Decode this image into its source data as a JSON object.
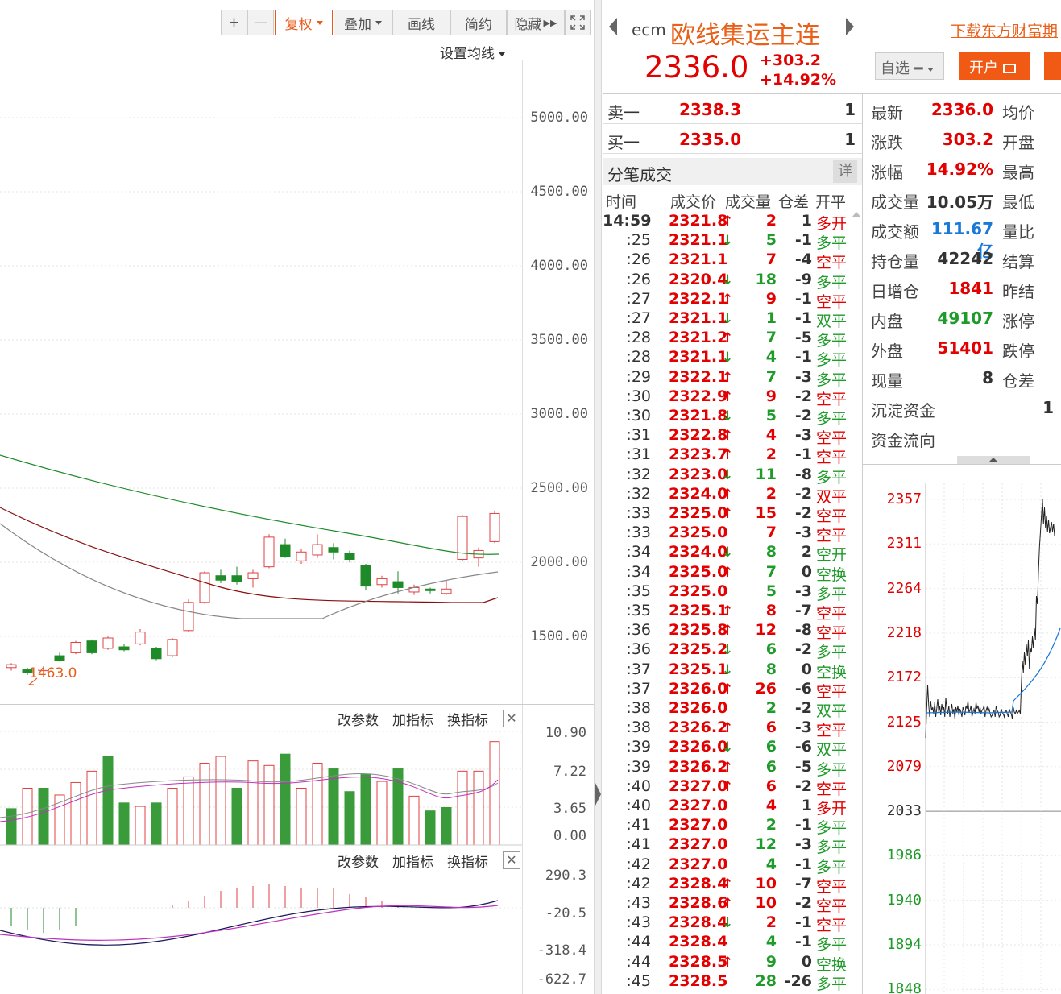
{
  "toolbar": {
    "plus_label": "+",
    "minus_label": "—",
    "fuquan_label": "复权",
    "diejia_label": "叠加",
    "huaxian_label": "画线",
    "jianyue_label": "简约",
    "yincang_label": "隐藏"
  },
  "kline": {
    "ma_setting_label": "设置均线",
    "price_axis": [
      "5000.00",
      "4500.00",
      "4000.00",
      "3500.00",
      "3000.00",
      "2500.00",
      "2000.00",
      "1500.00"
    ],
    "low_marker": "1463.0"
  },
  "volume_panel": {
    "buttons": [
      "改参数",
      "加指标",
      "换指标"
    ],
    "axis": [
      "10.90",
      "7.22",
      "3.65",
      "0.00"
    ]
  },
  "macd_panel": {
    "buttons": [
      "改参数",
      "加指标",
      "换指标"
    ],
    "axis": [
      "290.3",
      "-20.5",
      "-318.4",
      "-622.7"
    ]
  },
  "quote": {
    "code": "ecm",
    "name": "欧线集运主连",
    "download_link": "下载东方财富期",
    "price": "2336.0",
    "change": "+303.2",
    "change_pct": "+14.92%",
    "watch_label": "自选",
    "open_account_label": "开户",
    "colors": {
      "up": "#e30000",
      "down": "#1e9b28",
      "accent": "#e8601a"
    }
  },
  "orderbook": [
    {
      "label": "卖一",
      "price": "2338.3",
      "qty": "1"
    },
    {
      "label": "买一",
      "price": "2335.0",
      "qty": "1"
    }
  ],
  "ticks": {
    "title": "分笔成交",
    "detail_btn": "详",
    "headers": [
      "时间",
      "成交价",
      "成交量",
      "仓差",
      "开平"
    ],
    "rows": [
      {
        "t": "14:59",
        "p": "2321.8",
        "d": "up",
        "v": "2",
        "v_c": "red",
        "c": "1",
        "k": "多开",
        "k_c": "red"
      },
      {
        "t": ":25",
        "p": "2321.1",
        "d": "down",
        "v": "5",
        "v_c": "green",
        "c": "-1",
        "k": "多平",
        "k_c": "green"
      },
      {
        "t": ":26",
        "p": "2321.1",
        "d": "",
        "v": "7",
        "v_c": "red",
        "c": "-4",
        "k": "空平",
        "k_c": "red"
      },
      {
        "t": ":26",
        "p": "2320.4",
        "d": "down",
        "v": "18",
        "v_c": "green",
        "c": "-9",
        "k": "多平",
        "k_c": "green"
      },
      {
        "t": ":27",
        "p": "2322.1",
        "d": "up",
        "v": "9",
        "v_c": "red",
        "c": "-1",
        "k": "空平",
        "k_c": "red"
      },
      {
        "t": ":27",
        "p": "2321.1",
        "d": "down",
        "v": "1",
        "v_c": "green",
        "c": "-1",
        "k": "双平",
        "k_c": "green"
      },
      {
        "t": ":28",
        "p": "2321.2",
        "d": "up",
        "v": "7",
        "v_c": "green",
        "c": "-5",
        "k": "多平",
        "k_c": "green"
      },
      {
        "t": ":28",
        "p": "2321.1",
        "d": "down",
        "v": "4",
        "v_c": "green",
        "c": "-1",
        "k": "多平",
        "k_c": "green"
      },
      {
        "t": ":29",
        "p": "2322.1",
        "d": "up",
        "v": "7",
        "v_c": "green",
        "c": "-3",
        "k": "多平",
        "k_c": "green"
      },
      {
        "t": ":30",
        "p": "2322.9",
        "d": "up",
        "v": "9",
        "v_c": "red",
        "c": "-2",
        "k": "空平",
        "k_c": "red"
      },
      {
        "t": ":30",
        "p": "2321.8",
        "d": "down",
        "v": "5",
        "v_c": "green",
        "c": "-2",
        "k": "多平",
        "k_c": "green"
      },
      {
        "t": ":31",
        "p": "2322.8",
        "d": "up",
        "v": "4",
        "v_c": "red",
        "c": "-3",
        "k": "空平",
        "k_c": "red"
      },
      {
        "t": ":31",
        "p": "2323.7",
        "d": "up",
        "v": "2",
        "v_c": "red",
        "c": "-1",
        "k": "空平",
        "k_c": "red"
      },
      {
        "t": ":32",
        "p": "2323.0",
        "d": "down",
        "v": "11",
        "v_c": "green",
        "c": "-8",
        "k": "多平",
        "k_c": "green"
      },
      {
        "t": ":32",
        "p": "2324.0",
        "d": "up",
        "v": "2",
        "v_c": "red",
        "c": "-2",
        "k": "双平",
        "k_c": "red"
      },
      {
        "t": ":33",
        "p": "2325.0",
        "d": "up",
        "v": "15",
        "v_c": "red",
        "c": "-2",
        "k": "空平",
        "k_c": "red"
      },
      {
        "t": ":33",
        "p": "2325.0",
        "d": "",
        "v": "7",
        "v_c": "red",
        "c": "-3",
        "k": "空平",
        "k_c": "red"
      },
      {
        "t": ":34",
        "p": "2324.0",
        "d": "down",
        "v": "8",
        "v_c": "green",
        "c": "2",
        "k": "空开",
        "k_c": "green"
      },
      {
        "t": ":34",
        "p": "2325.0",
        "d": "up",
        "v": "7",
        "v_c": "green",
        "c": "0",
        "k": "空换",
        "k_c": "green"
      },
      {
        "t": ":35",
        "p": "2325.0",
        "d": "",
        "v": "5",
        "v_c": "green",
        "c": "-3",
        "k": "多平",
        "k_c": "green"
      },
      {
        "t": ":35",
        "p": "2325.1",
        "d": "up",
        "v": "8",
        "v_c": "red",
        "c": "-7",
        "k": "空平",
        "k_c": "red"
      },
      {
        "t": ":36",
        "p": "2325.8",
        "d": "up",
        "v": "12",
        "v_c": "red",
        "c": "-8",
        "k": "空平",
        "k_c": "red"
      },
      {
        "t": ":36",
        "p": "2325.2",
        "d": "down",
        "v": "6",
        "v_c": "green",
        "c": "-2",
        "k": "多平",
        "k_c": "green"
      },
      {
        "t": ":37",
        "p": "2325.1",
        "d": "down",
        "v": "8",
        "v_c": "green",
        "c": "0",
        "k": "空换",
        "k_c": "green"
      },
      {
        "t": ":37",
        "p": "2326.0",
        "d": "up",
        "v": "26",
        "v_c": "red",
        "c": "-6",
        "k": "空平",
        "k_c": "red"
      },
      {
        "t": ":38",
        "p": "2326.0",
        "d": "",
        "v": "2",
        "v_c": "green",
        "c": "-2",
        "k": "双平",
        "k_c": "green"
      },
      {
        "t": ":38",
        "p": "2326.2",
        "d": "up",
        "v": "6",
        "v_c": "red",
        "c": "-3",
        "k": "空平",
        "k_c": "red"
      },
      {
        "t": ":39",
        "p": "2326.0",
        "d": "down",
        "v": "6",
        "v_c": "green",
        "c": "-6",
        "k": "双平",
        "k_c": "green"
      },
      {
        "t": ":39",
        "p": "2326.2",
        "d": "up",
        "v": "6",
        "v_c": "green",
        "c": "-5",
        "k": "多平",
        "k_c": "green"
      },
      {
        "t": ":40",
        "p": "2327.0",
        "d": "up",
        "v": "6",
        "v_c": "red",
        "c": "-2",
        "k": "空平",
        "k_c": "red"
      },
      {
        "t": ":40",
        "p": "2327.0",
        "d": "",
        "v": "4",
        "v_c": "red",
        "c": "1",
        "k": "多开",
        "k_c": "red"
      },
      {
        "t": ":41",
        "p": "2327.0",
        "d": "",
        "v": "2",
        "v_c": "green",
        "c": "-1",
        "k": "多平",
        "k_c": "green"
      },
      {
        "t": ":41",
        "p": "2327.0",
        "d": "",
        "v": "12",
        "v_c": "green",
        "c": "-3",
        "k": "多平",
        "k_c": "green"
      },
      {
        "t": ":42",
        "p": "2327.0",
        "d": "",
        "v": "4",
        "v_c": "green",
        "c": "-1",
        "k": "多平",
        "k_c": "green"
      },
      {
        "t": ":42",
        "p": "2328.4",
        "d": "up",
        "v": "10",
        "v_c": "red",
        "c": "-7",
        "k": "空平",
        "k_c": "red"
      },
      {
        "t": ":43",
        "p": "2328.6",
        "d": "up",
        "v": "10",
        "v_c": "red",
        "c": "-2",
        "k": "空平",
        "k_c": "red"
      },
      {
        "t": ":43",
        "p": "2328.4",
        "d": "down",
        "v": "2",
        "v_c": "red",
        "c": "-1",
        "k": "空平",
        "k_c": "red"
      },
      {
        "t": ":44",
        "p": "2328.4",
        "d": "",
        "v": "4",
        "v_c": "green",
        "c": "-1",
        "k": "多平",
        "k_c": "green"
      },
      {
        "t": ":44",
        "p": "2328.5",
        "d": "up",
        "v": "9",
        "v_c": "green",
        "c": "0",
        "k": "空换",
        "k_c": "green"
      },
      {
        "t": ":45",
        "p": "2328.5",
        "d": "",
        "v": "28",
        "v_c": "green",
        "c": "-26",
        "k": "多平",
        "k_c": "green"
      }
    ]
  },
  "stats": [
    {
      "label": "最新",
      "value": "2336.0",
      "color": "red",
      "label2": "均价"
    },
    {
      "label": "涨跌",
      "value": "303.2",
      "color": "red",
      "label2": "开盘"
    },
    {
      "label": "涨幅",
      "value": "14.92%",
      "color": "red",
      "label2": "最高"
    },
    {
      "label": "成交量",
      "value": "10.05万",
      "color": "black",
      "label2": "最低"
    },
    {
      "label": "成交额",
      "value": "111.67亿",
      "color": "blue",
      "label2": "量比"
    },
    {
      "label": "持仓量",
      "value": "42242",
      "color": "black",
      "label2": "结算"
    },
    {
      "label": "日增仓",
      "value": "1841",
      "color": "red",
      "label2": "昨结"
    },
    {
      "label": "内盘",
      "value": "49107",
      "color": "green",
      "label2": "涨停"
    },
    {
      "label": "外盘",
      "value": "51401",
      "color": "red",
      "label2": "跌停"
    },
    {
      "label": "现量",
      "value": "8",
      "color": "black",
      "label2": "仓差"
    },
    {
      "label": "沉淀资金",
      "value": "1",
      "color": "black",
      "label2": ""
    },
    {
      "label": "资金流向",
      "value": "",
      "color": "black",
      "label2": ""
    }
  ],
  "intraday_axis": [
    "2357",
    "2311",
    "2264",
    "2218",
    "2172",
    "2125",
    "2079",
    "2033",
    "1986",
    "1940",
    "1894",
    "1848"
  ]
}
